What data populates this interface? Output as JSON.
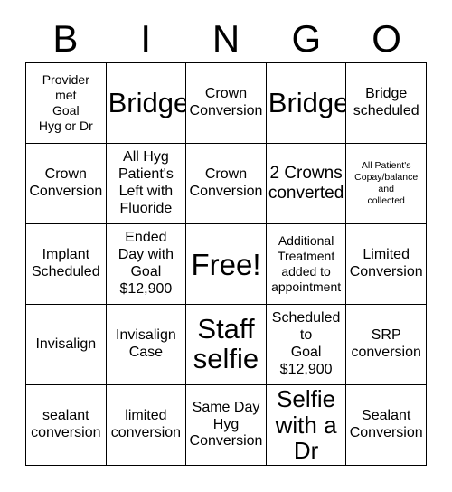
{
  "card": {
    "header": {
      "letters": [
        "B",
        "I",
        "N",
        "G",
        "O"
      ]
    },
    "rows": [
      [
        {
          "text": "Provider\nmet\nGoal\nHyg or Dr",
          "size": "sm"
        },
        {
          "text": "Bridge",
          "size": "xxl"
        },
        {
          "text": "Crown\nConversion",
          "size": "md"
        },
        {
          "text": "Bridge",
          "size": "xxl"
        },
        {
          "text": "Bridge\nscheduled",
          "size": "md"
        }
      ],
      [
        {
          "text": "Crown\nConversion",
          "size": "md"
        },
        {
          "text": "All Hyg\nPatient's\nLeft with\nFluoride",
          "size": "md"
        },
        {
          "text": "Crown\nConversion",
          "size": "md"
        },
        {
          "text": "2 Crowns\nconverted",
          "size": "lg"
        },
        {
          "text": "All Patient's\nCopay/balance\nand\ncollected",
          "size": "xs"
        }
      ],
      [
        {
          "text": "Implant\nScheduled",
          "size": "md"
        },
        {
          "text": "Ended\nDay with\nGoal\n$12,900",
          "size": "md"
        },
        {
          "text": "Free!",
          "size": "free"
        },
        {
          "text": "Additional\nTreatment\nadded to\nappointment",
          "size": "sm"
        },
        {
          "text": "Limited\nConversion",
          "size": "md"
        }
      ],
      [
        {
          "text": "Invisalign",
          "size": "md"
        },
        {
          "text": "Invisalign\nCase",
          "size": "md"
        },
        {
          "text": "Staff\nselfie",
          "size": "xxl"
        },
        {
          "text": "Scheduled\nto\nGoal\n$12,900",
          "size": "md"
        },
        {
          "text": "SRP\nconversion",
          "size": "md"
        }
      ],
      [
        {
          "text": "sealant\nconversion",
          "size": "md"
        },
        {
          "text": "limited\nconversion",
          "size": "md"
        },
        {
          "text": "Same Day\nHyg\nConversion",
          "size": "md"
        },
        {
          "text": "Selfie\nwith a\nDr",
          "size": "xl"
        },
        {
          "text": "Sealant\nConversion",
          "size": "md"
        }
      ]
    ]
  },
  "colors": {
    "background": "#ffffff",
    "text": "#000000",
    "border": "#000000"
  }
}
